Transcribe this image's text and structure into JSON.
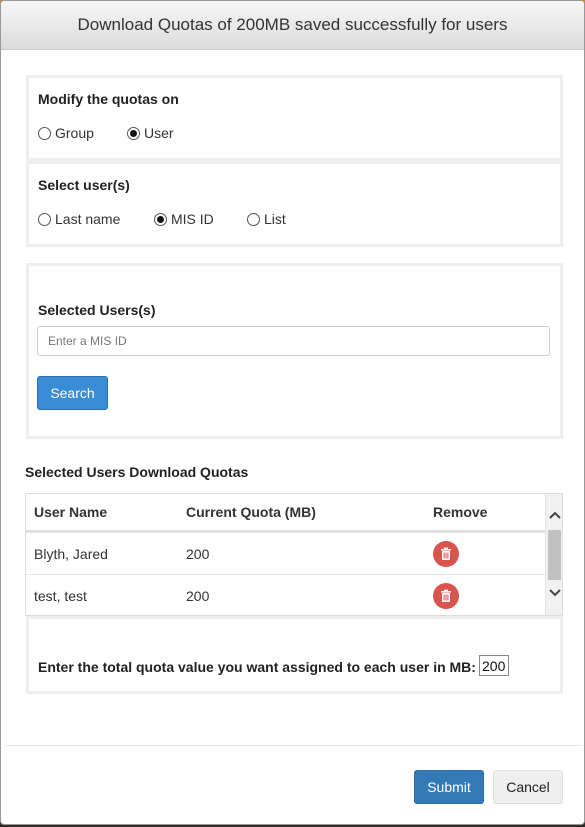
{
  "header": {
    "title": "Download Quotas of 200MB saved successfully for users"
  },
  "modify": {
    "label": "Modify the quotas on",
    "options": [
      {
        "label": "Group",
        "checked": false
      },
      {
        "label": "User",
        "checked": true
      }
    ]
  },
  "select_users": {
    "label": "Select user(s)",
    "options": [
      {
        "label": "Last name",
        "checked": false
      },
      {
        "label": "MIS ID",
        "checked": true
      },
      {
        "label": "List",
        "checked": false
      }
    ]
  },
  "selected": {
    "label": "Selected Users(s)",
    "placeholder": "Enter a MIS ID",
    "search_label": "Search"
  },
  "quotas_table": {
    "title": "Selected Users Download Quotas",
    "columns": [
      "User Name",
      "Current Quota (MB)",
      "Remove"
    ],
    "rows": [
      {
        "name": "Blyth, Jared",
        "quota": "200"
      },
      {
        "name": "test, test",
        "quota": "200"
      }
    ]
  },
  "quota_entry": {
    "label": "Enter the total quota value you want assigned to each user in MB:",
    "value": "200"
  },
  "footer": {
    "submit_label": "Submit",
    "cancel_label": "Cancel"
  },
  "colors": {
    "primary": "#337ab7",
    "danger": "#d9534f"
  }
}
